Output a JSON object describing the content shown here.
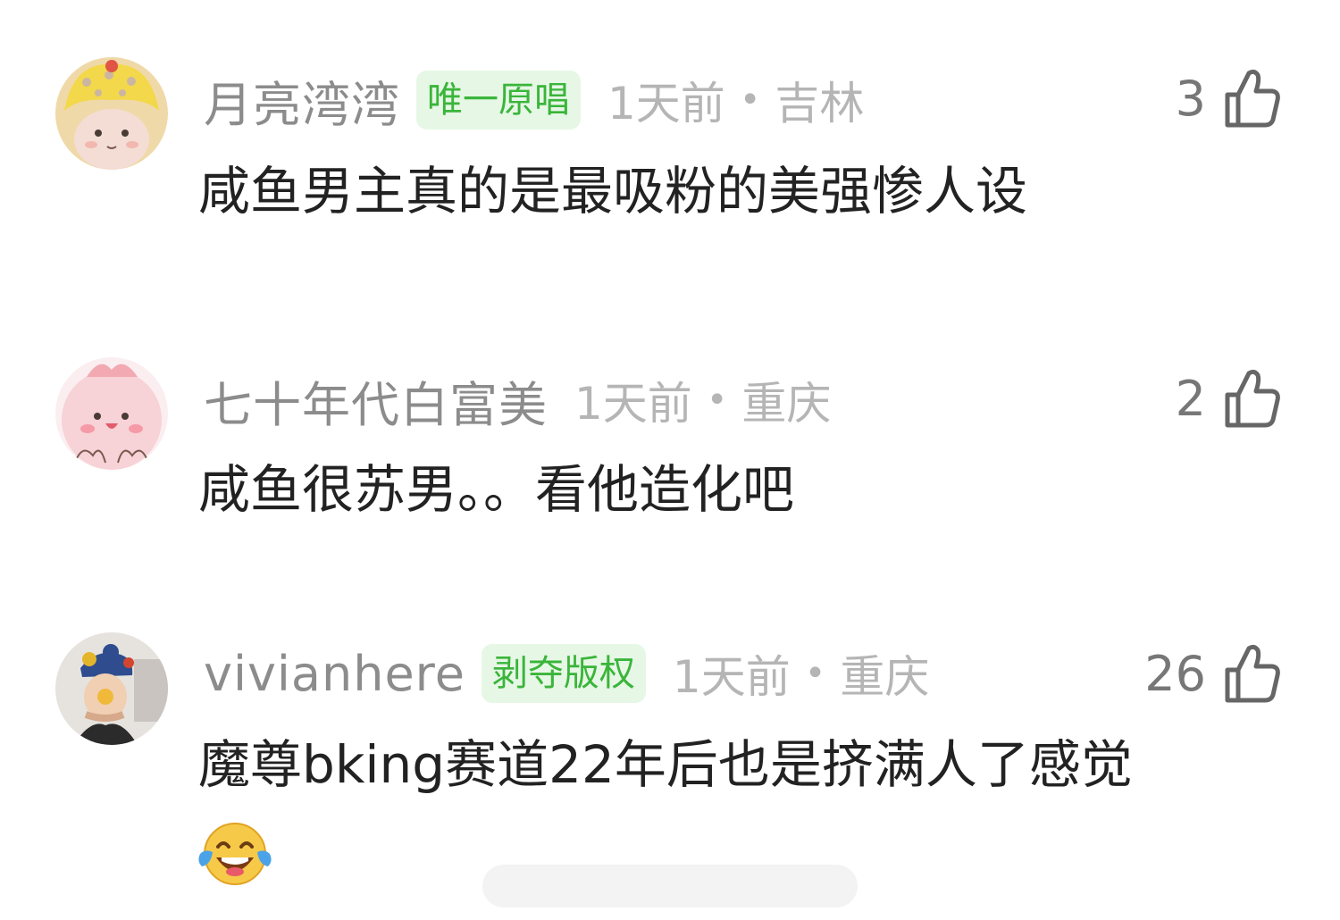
{
  "comments": [
    {
      "username": "月亮湾湾",
      "badge": "唯一原唱",
      "time": "1天前",
      "separator": "•",
      "location": "吉林",
      "likes": "3",
      "text": "咸鱼男主真的是最吸粉的美强惨人设"
    },
    {
      "username": "七十年代白富美",
      "badge": "",
      "time": "1天前",
      "separator": "•",
      "location": "重庆",
      "likes": "2",
      "text": "咸鱼很苏男。。看他造化吧"
    },
    {
      "username": "vivianhere",
      "badge": "剥夺版权",
      "time": "1天前",
      "separator": "•",
      "location": "重庆",
      "likes": "26",
      "text": "魔尊bking赛道22年后也是挤满人了感觉",
      "emoji": "laughing-tears-emoji"
    }
  ],
  "icons": {
    "like": "thumbs-up-icon"
  },
  "colors": {
    "badge_bg": "#e6f7e6",
    "badge_text": "#3ab53a",
    "username": "#8c8c8c",
    "meta": "#b5b5b5",
    "text": "#222222"
  }
}
